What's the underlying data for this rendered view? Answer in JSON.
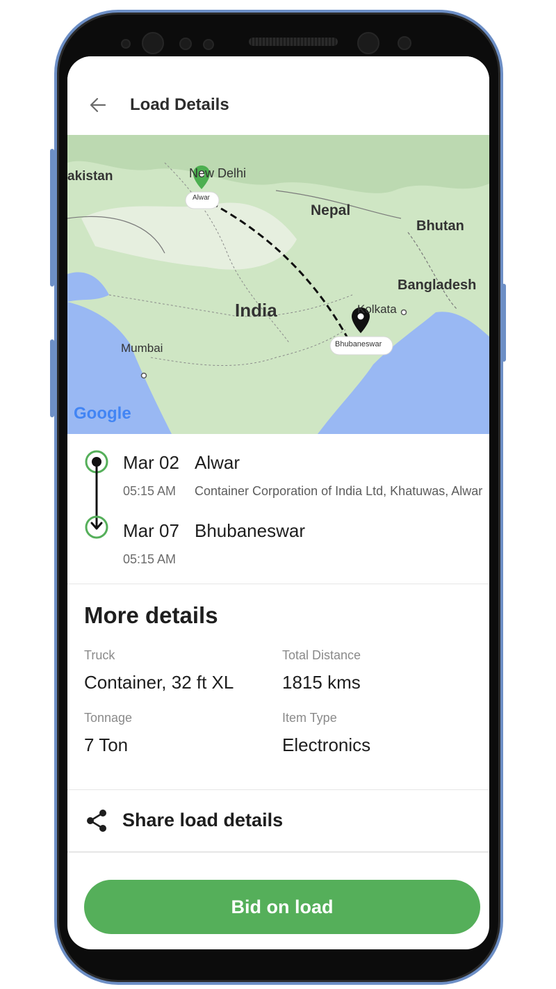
{
  "header": {
    "title": "Load Details"
  },
  "map": {
    "labels": {
      "pakistan": "akistan",
      "new_delhi": "New Delhi",
      "nepal": "Nepal",
      "bhutan": "Bhutan",
      "bangladesh": "Bangladesh",
      "india": "India",
      "kolkata": "Kolkata",
      "mumbai": "Mumbai"
    },
    "origin_tag": "Alwar",
    "destination_tag": "Bhubaneswar",
    "attribution": "Google"
  },
  "route": {
    "pickup": {
      "date": "Mar 02",
      "city": "Alwar",
      "time": "05:15 AM",
      "address": "Container Corporation of India Ltd, Khatuwas, Alwar"
    },
    "drop": {
      "date": "Mar 07",
      "city": "Bhubaneswar",
      "time": "05:15 AM"
    }
  },
  "more_details": {
    "heading": "More details",
    "truck_label": "Truck",
    "truck_value": "Container, 32 ft XL",
    "distance_label": "Total Distance",
    "distance_value": "1815 kms",
    "tonnage_label": "Tonnage",
    "tonnage_value": "7 Ton",
    "item_label": "Item Type",
    "item_value": "Electronics"
  },
  "share": {
    "label": "Share load details"
  },
  "action": {
    "bid_label": "Bid on load"
  },
  "colors": {
    "accent": "#55af5a",
    "map_land": "#cfe6c4",
    "map_water": "#99b8f3"
  }
}
